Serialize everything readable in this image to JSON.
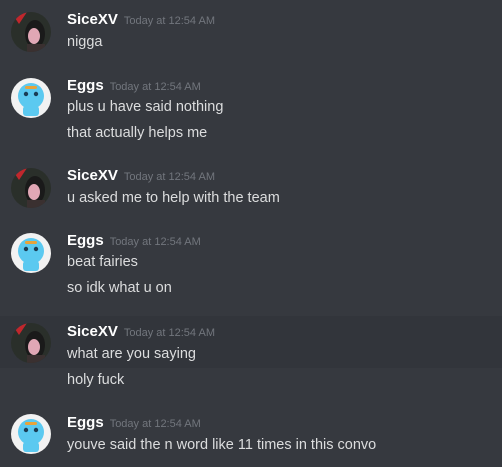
{
  "messages": [
    {
      "author": "SiceXV",
      "timestamp": "Today at 12:54 AM",
      "avatar": "sicexv-avatar",
      "lines": [
        "nigga"
      ]
    },
    {
      "author": "Eggs",
      "timestamp": "Today at 12:54 AM",
      "avatar": "eggs-avatar",
      "lines": [
        "plus u have said nothing",
        "that actually helps me"
      ]
    },
    {
      "author": "SiceXV",
      "timestamp": "Today at 12:54 AM",
      "avatar": "sicexv-avatar",
      "lines": [
        "u asked me to help with the team"
      ]
    },
    {
      "author": "Eggs",
      "timestamp": "Today at 12:54 AM",
      "avatar": "eggs-avatar",
      "lines": [
        "beat fairies",
        "so idk what u on"
      ]
    },
    {
      "author": "SiceXV",
      "timestamp": "Today at 12:54 AM",
      "avatar": "sicexv-avatar",
      "lines": [
        "what are you saying",
        "holy fuck"
      ]
    },
    {
      "author": "Eggs",
      "timestamp": "Today at 12:54 AM",
      "avatar": "eggs-avatar",
      "lines": [
        "youve said the n word like 11 times in this convo"
      ]
    }
  ],
  "colors": {
    "background": "#36393f",
    "username": "#ffffff",
    "timestamp": "#72767d",
    "message_text": "#dcddde",
    "eggs_avatar": "#5bc9f0",
    "sicexv_avatar": "#2a2f2a"
  }
}
